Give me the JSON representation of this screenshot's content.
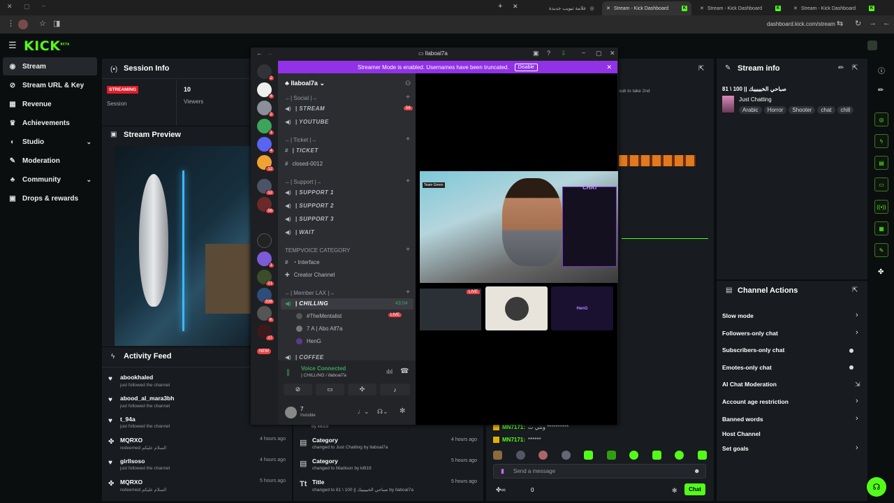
{
  "browser": {
    "tabs": [
      {
        "title": "علامة تبويب جديدة"
      },
      {
        "title": "Stream - Kick Dashboard"
      },
      {
        "title": "Stream - Kick Dashboard"
      },
      {
        "title": "Stream - Kick Dashboard"
      }
    ],
    "url": "dashboard.kick.com/stream"
  },
  "kick": {
    "logo": "KICK",
    "beta": "BETA",
    "sidebar": [
      {
        "label": "Stream"
      },
      {
        "label": "Stream URL & Key"
      },
      {
        "label": "Revenue"
      },
      {
        "label": "Achievements"
      },
      {
        "label": "Studio"
      },
      {
        "label": "Moderation"
      },
      {
        "label": "Community"
      },
      {
        "label": "Drops & rewards"
      }
    ],
    "session": {
      "title": "Session Info",
      "status": "STREAMING",
      "session_label": "Session",
      "viewers_value": "10",
      "viewers_label": "Viewers"
    },
    "preview": {
      "title": "Stream Preview"
    },
    "activity": {
      "title": "Activity Feed",
      "items": [
        {
          "name": "abookhaled",
          "sub": "just followed the channel",
          "time": ""
        },
        {
          "name": "abood_al_mara3bh",
          "sub": "just followed the channel",
          "time": ""
        },
        {
          "name": "t_94a",
          "sub": "just followed the channel",
          "time": ""
        },
        {
          "name": "MQRXO",
          "sub": "redeemed السلام عليكم",
          "time": "4 hours ago"
        },
        {
          "name": "girllsoso",
          "sub": "just followed the channel",
          "time": "4 hours ago"
        },
        {
          "name": "MQRXO",
          "sub": "redeemed السلام عليكم",
          "time": "5 hours ago"
        }
      ]
    },
    "mod_log": [
      {
        "title": "Category",
        "sub": "changed to Just Chatting by llaboal7a",
        "time": "4 hours ago"
      },
      {
        "title": "Category",
        "sub": "changed to Madison by k8l19",
        "time": "5 hours ago"
      },
      {
        "title": "Title",
        "sub": "changed to 81 \\ 100 || صباحي الخيييييك by llaboal7a",
        "time": "5 hours ago"
      }
    ],
    "mod_log_top": "by k8l19",
    "chat": {
      "lines": [
        {
          "user": "MN7171:",
          "text": "ونتي ت **********"
        },
        {
          "user": "MN7171:",
          "text": "******"
        }
      ],
      "placeholder": "Send a message",
      "send": "Chat",
      "count": "0",
      "snippet": "sub to take 2nd"
    },
    "stream_info": {
      "title": "Stream info",
      "stream_title": "صباحي الخيييييك || 100 \\ 81",
      "category": "Just Chatting",
      "tags": [
        "Arabic",
        "Horror",
        "Shooter",
        "chat",
        "chill"
      ]
    },
    "channel_actions": {
      "title": "Channel Actions",
      "items": [
        {
          "label": "Slow mode",
          "kind": "chevron"
        },
        {
          "label": "Followers-only chat",
          "kind": "chevron"
        },
        {
          "label": "Subscribers-only chat",
          "kind": "toggle"
        },
        {
          "label": "Emotes-only chat",
          "kind": "toggle"
        },
        {
          "label": "AI Chat Moderation",
          "kind": "external"
        },
        {
          "label": "Account age restriction",
          "kind": "chevron"
        },
        {
          "label": "Banned words",
          "kind": "chevron"
        },
        {
          "label": "Host Channel",
          "kind": "none"
        },
        {
          "label": "Set goals",
          "kind": "chevron"
        }
      ]
    }
  },
  "discord": {
    "window_title": "llaboal7a",
    "banner": "Streamer Mode is enabled. Usernames have been truncated.",
    "banner_button": "Disable",
    "server_name": "llaboal7a",
    "server_badges": [
      "2",
      "4",
      "2",
      "1",
      "4",
      "12",
      "12",
      "56",
      "1",
      "21",
      "338",
      "K",
      "27",
      "NEW"
    ],
    "categories": [
      {
        "name": "←| Social |→",
        "channels": [
          {
            "name": "| STREAM",
            "count": "56"
          },
          {
            "name": "| YOUTUBE",
            "count": ""
          }
        ]
      },
      {
        "name": "←| Ticket |→",
        "channels": [
          {
            "name": "| TICKET",
            "count": ""
          },
          {
            "name": "closed-0012",
            "count": ""
          }
        ]
      },
      {
        "name": "←| Support |→",
        "channels": [
          {
            "name": "| SUPPORT 1",
            "count": ""
          },
          {
            "name": "| SUPPORT 2",
            "count": ""
          },
          {
            "name": "| SUPPORT 3",
            "count": ""
          },
          {
            "name": "| WAIT",
            "count": ""
          }
        ]
      },
      {
        "name": "TEMPVOICE CATEGORY",
        "channels": [
          {
            "name": "・Interface",
            "count": ""
          },
          {
            "name": "Creator Channel",
            "count": ""
          }
        ]
      },
      {
        "name": "←| Member LAX |→",
        "channels": [
          {
            "name": "| CHILLING",
            "count": "43:04"
          }
        ]
      }
    ],
    "voice_users": [
      {
        "name": "#TheMentalist",
        "live": "LIVE"
      },
      {
        "name": "7 A | Abo Alf7a",
        "live": ""
      },
      {
        "name": "HenG",
        "live": ""
      }
    ],
    "next_channel": "| COFFEE",
    "voice_status": "Voice Connected",
    "voice_channel": "| CHILLING / llaboal7a",
    "user_name": "7",
    "user_status": "Invisible",
    "stream_tile_live": "LIVE",
    "stream_tile_name": "HenG",
    "overlay_label": "CHAT",
    "overlay_team": "Team Green"
  }
}
